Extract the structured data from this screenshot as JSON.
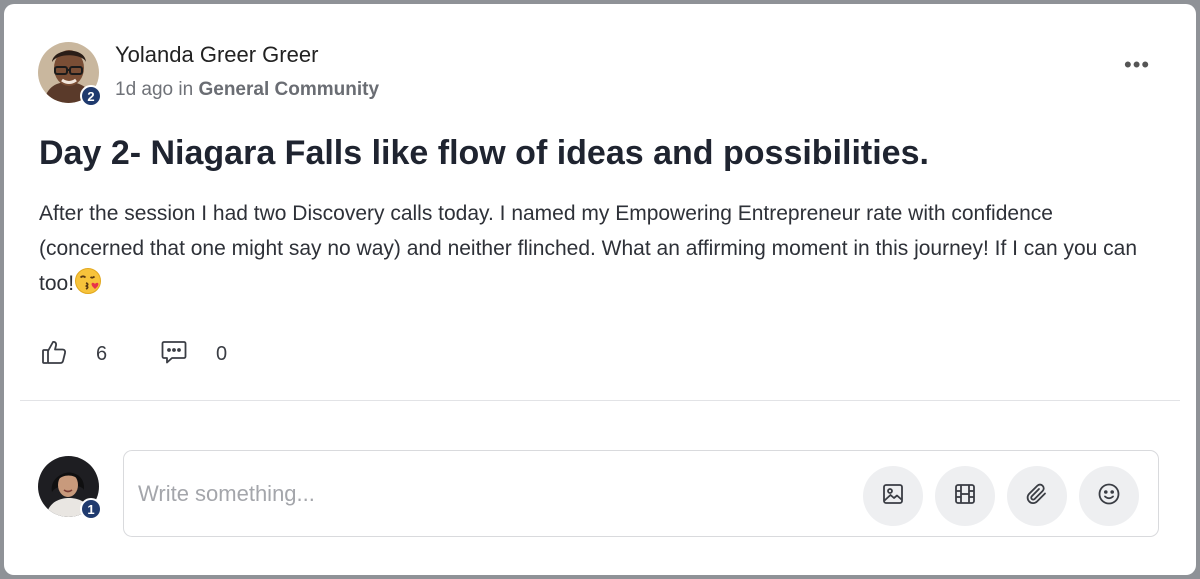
{
  "post": {
    "author": {
      "name": "Yolanda Greer Greer",
      "level": "2"
    },
    "meta": {
      "time": "1d ago",
      "in_word": "in",
      "community": "General Community"
    },
    "more_label": "•••",
    "title": "Day 2- Niagara Falls like flow of ideas and possibilities.",
    "body": "After the session I had two Discovery calls today. I named my Empowering Entrepreneur rate with confidence (concerned that one might say no way) and neither flinched. What an affirming moment in this journey! If I can you can too!",
    "likes": "6",
    "comments": "0"
  },
  "composer": {
    "user_level": "1",
    "placeholder": "Write something..."
  },
  "colors": {
    "badge": "#1f3a6e",
    "title": "#1f2430",
    "muted": "#6f7278"
  }
}
